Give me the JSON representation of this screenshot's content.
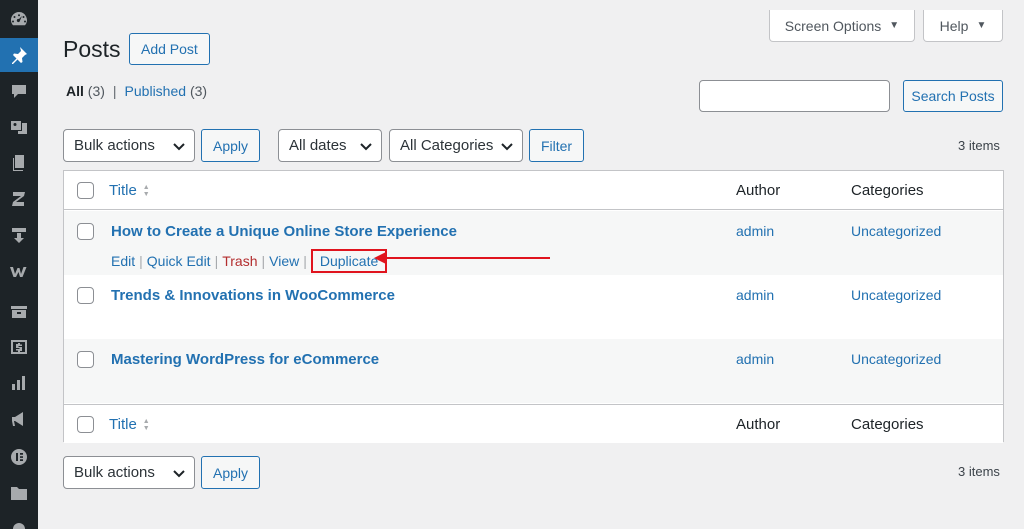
{
  "sidebar": {
    "items": [
      {
        "icon": "dashboard-icon",
        "active": false
      },
      {
        "icon": "pin-icon",
        "active": true
      },
      {
        "icon": "comments-icon",
        "active": false
      },
      {
        "icon": "media-icon",
        "active": false
      },
      {
        "icon": "pages-icon",
        "active": false
      },
      {
        "icon": "z-plugin-icon",
        "active": false
      },
      {
        "icon": "download-icon",
        "active": false
      },
      {
        "icon": "woocommerce-icon",
        "active": false
      },
      {
        "icon": "products-icon",
        "active": false
      },
      {
        "icon": "payments-icon",
        "active": false
      },
      {
        "icon": "analytics-icon",
        "active": false
      },
      {
        "icon": "marketing-icon",
        "active": false
      },
      {
        "icon": "elementor-icon",
        "active": false
      },
      {
        "icon": "templates-icon",
        "active": false
      }
    ]
  },
  "header": {
    "screen_options": "Screen Options",
    "help": "Help",
    "title": "Posts",
    "add_new": "Add Post"
  },
  "filters_links": {
    "all_label": "All",
    "all_count": "(3)",
    "separator": "|",
    "published_label": "Published",
    "published_count": "(3)"
  },
  "search": {
    "value": "",
    "button": "Search Posts"
  },
  "tablenav_top": {
    "bulk_actions": "Bulk actions",
    "apply": "Apply",
    "dates": "All dates",
    "categories": "All Categories",
    "filter": "Filter",
    "items": "3 items"
  },
  "columns": {
    "title": "Title",
    "author": "Author",
    "categories": "Categories"
  },
  "rows": [
    {
      "title": "How to Create a Unique Online Store Experience",
      "author": "admin",
      "category": "Uncategorized",
      "actions": {
        "edit": "Edit",
        "quick_edit": "Quick Edit",
        "trash": "Trash",
        "view": "View",
        "duplicate": "Duplicate",
        "sep": "|"
      }
    },
    {
      "title": "Trends & Innovations in WooCommerce",
      "author": "admin",
      "category": "Uncategorized"
    },
    {
      "title": "Mastering WordPress for eCommerce",
      "author": "admin",
      "category": "Uncategorized"
    }
  ],
  "tablenav_bottom": {
    "bulk_actions": "Bulk actions",
    "apply": "Apply",
    "items": "3 items"
  },
  "colors": {
    "accent": "#2271b1",
    "sidebar_bg": "#1d2327",
    "highlight_red": "#e0141e"
  }
}
